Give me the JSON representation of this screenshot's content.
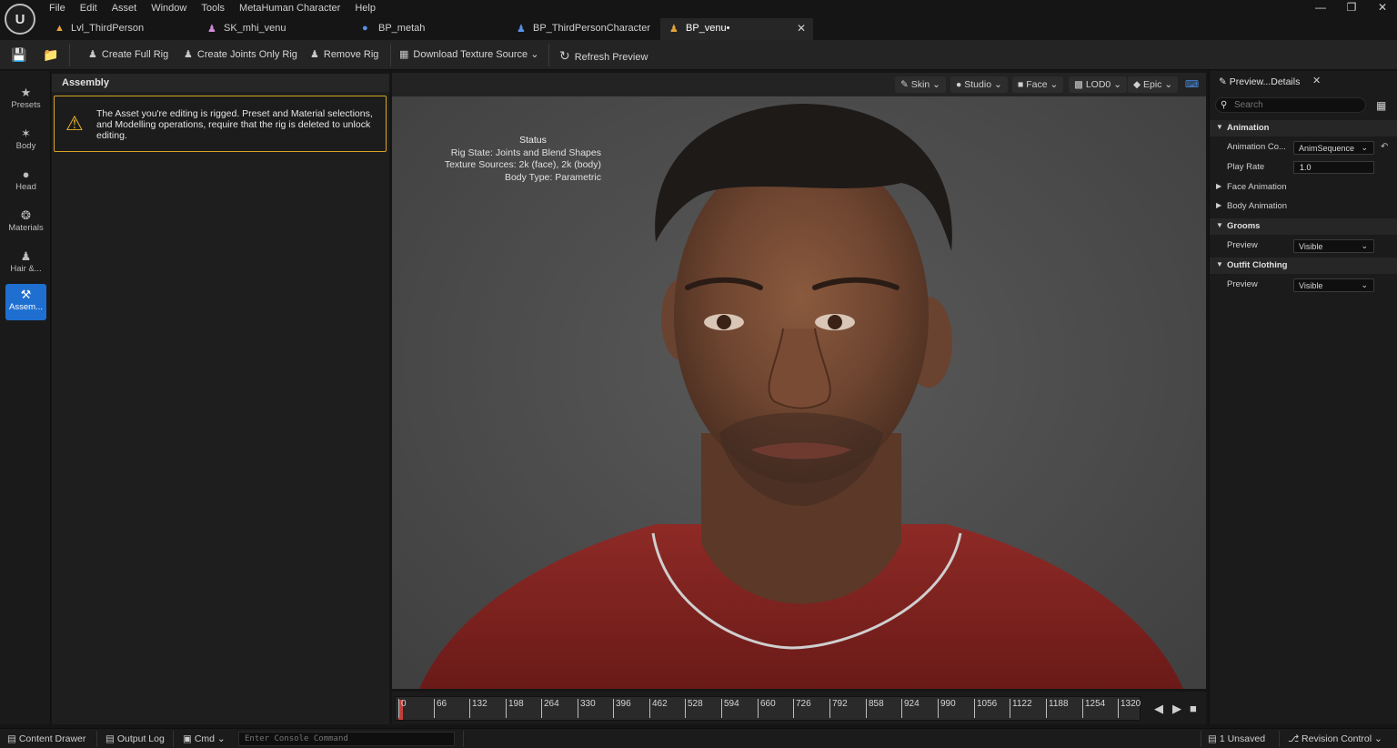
{
  "menu": [
    "File",
    "Edit",
    "Asset",
    "Window",
    "Tools",
    "MetaHuman Character",
    "Help"
  ],
  "tabs": [
    {
      "label": "Lvl_ThirdPerson",
      "icon": "level-icon"
    },
    {
      "label": "SK_mhi_venu",
      "icon": "skeletal-mesh-icon"
    },
    {
      "label": "BP_metah",
      "icon": "blueprint-icon"
    },
    {
      "label": "BP_ThirdPersonCharacter",
      "icon": "blueprint-icon"
    },
    {
      "label": "BP_venu•",
      "icon": "metahuman-icon",
      "active": true
    }
  ],
  "toolbar": {
    "create_full_rig": "Create Full Rig",
    "create_joints_only_rig": "Create Joints Only Rig",
    "remove_rig": "Remove Rig",
    "download_texture_source": "Download Texture Source",
    "refresh_preview": "Refresh Preview"
  },
  "rail": [
    {
      "label": "Presets",
      "icon": "star-icon"
    },
    {
      "label": "Body",
      "icon": "body-icon"
    },
    {
      "label": "Head",
      "icon": "head-icon"
    },
    {
      "label": "Materials",
      "icon": "materials-icon"
    },
    {
      "label": "Hair &...",
      "icon": "hair-icon"
    },
    {
      "label": "Assem...",
      "icon": "assembly-icon",
      "active": true
    }
  ],
  "assembly": {
    "title": "Assembly",
    "warning": "The Asset you're editing is rigged. Preset and Material selections, and Modelling operations, require that the rig is deleted to unlock editing."
  },
  "viewport": {
    "buttons": [
      "Skin",
      "Studio",
      "Face",
      "LOD0",
      "Epic"
    ],
    "status_title": "Status",
    "status_lines": [
      "Rig State: Joints and Blend Shapes",
      "Texture Sources: 2k (face), 2k (body)",
      "Body Type: Parametric"
    ]
  },
  "timeline": {
    "ticks": [
      "0",
      "66",
      "132",
      "198",
      "264",
      "330",
      "396",
      "462",
      "528",
      "594",
      "660",
      "726",
      "792",
      "858",
      "924",
      "990",
      "1056",
      "1122",
      "1188",
      "1254",
      "1320"
    ]
  },
  "details": {
    "tab_title": "Preview...Details",
    "search_placeholder": "Search",
    "animation_header": "Animation",
    "anim_control_label": "Animation Co...",
    "anim_control_value": "AnimSequence",
    "play_rate_label": "Play Rate",
    "play_rate_value": "1.0",
    "face_animation": "Face Animation",
    "body_animation": "Body Animation",
    "grooms_header": "Grooms",
    "grooms_preview_label": "Preview",
    "grooms_preview_value": "Visible",
    "outfit_header": "Outfit Clothing",
    "outfit_preview_label": "Preview",
    "outfit_preview_value": "Visible"
  },
  "bottombar": {
    "content_drawer": "Content Drawer",
    "output_log": "Output Log",
    "cmd": "Cmd",
    "console_placeholder": "Enter Console Command",
    "unsaved": "1 Unsaved",
    "revision_control": "Revision Control"
  }
}
